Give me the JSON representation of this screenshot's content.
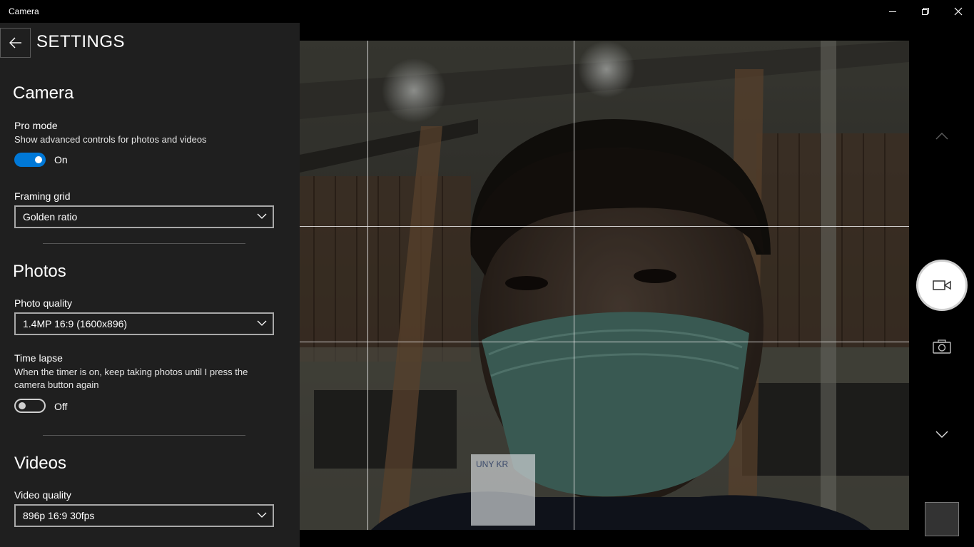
{
  "window": {
    "title": "Camera"
  },
  "settings": {
    "title": "SETTINGS",
    "camera": {
      "heading": "Camera",
      "pro_mode": {
        "label": "Pro mode",
        "description": "Show advanced controls for photos and videos",
        "state": "On",
        "enabled": true
      },
      "framing_grid": {
        "label": "Framing grid",
        "value": "Golden ratio"
      }
    },
    "photos": {
      "heading": "Photos",
      "photo_quality": {
        "label": "Photo quality",
        "value": "1.4MP 16:9 (1600x896)"
      },
      "time_lapse": {
        "label": "Time lapse",
        "description": "When the timer is on, keep taking photos until I press the camera button again",
        "state": "Off",
        "enabled": false
      }
    },
    "videos": {
      "heading": "Videos",
      "video_quality": {
        "label": "Video quality",
        "value": "896p 16:9 30fps"
      }
    }
  },
  "controls": {
    "icons": [
      "chevron-up-icon",
      "video-camera-icon",
      "photo-camera-icon",
      "chevron-down-icon"
    ]
  },
  "colors": {
    "accent": "#0078d7",
    "panel_bg": "#1f1f1f"
  }
}
